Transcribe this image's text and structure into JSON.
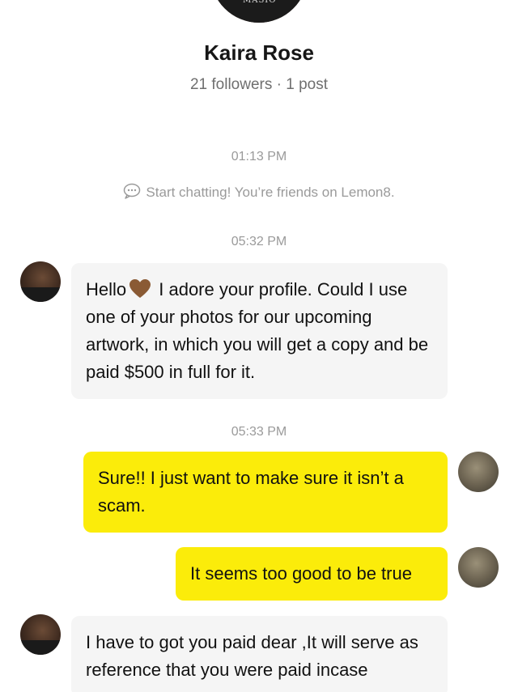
{
  "profile": {
    "name": "Kaira Rose",
    "stats": "21 followers · 1 post",
    "avatar_icon": "profile-photo"
  },
  "timestamps": {
    "t1": "01:13 PM",
    "t2": "05:32 PM",
    "t3": "05:33 PM"
  },
  "system_note": {
    "icon": "chat-bubble-icon",
    "text": "Start chatting! You’re friends on Lemon8."
  },
  "messages": [
    {
      "sender": "other",
      "before_heart": "Hello",
      "heart_color": "#8a5a34",
      "after_heart": " I adore your profile. Could I use one of your photos for our upcoming artwork, in which you will get a copy and be paid $500 in full for it."
    },
    {
      "sender": "me",
      "text": "Sure!! I just want to make sure it isn’t a scam."
    },
    {
      "sender": "me",
      "text": "It seems too good to be true"
    },
    {
      "sender": "other",
      "text": "I have to got you paid dear ,It will serve as reference that you were paid incase"
    }
  ],
  "colors": {
    "outgoing_bubble": "#fbec0a",
    "incoming_bubble": "#f5f5f5",
    "meta_text": "#9a9a9a"
  }
}
